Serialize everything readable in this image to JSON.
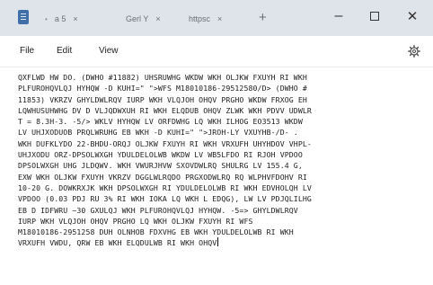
{
  "titlebar": {
    "tabs": [
      {
        "label": "a 5",
        "dot": "•",
        "close": "×"
      },
      {
        "label": "Gerl Y",
        "dot": "•",
        "close": "×"
      },
      {
        "label": "httpsc",
        "dot": "•",
        "close": "×"
      }
    ],
    "new_tab": "+",
    "controls": {
      "minimize": "–",
      "close": "✕"
    }
  },
  "menu": {
    "file": "File",
    "edit": "Edit",
    "view": "View"
  },
  "icons": {
    "app": "notepad-icon",
    "settings": "gear-icon"
  },
  "editor": {
    "lines": [
      "QXFLWD HW DO. (DWHO #11882) UHSRUWHG WKDW WKH OLJKW FXUYH RI WKH",
      "PLFUROHQVLQJ HYHQW -D KUHI=\" \">WFS M18010186-29512580/D> (DWHO #",
      "11853) VKRZV GHYLDWLRQV IURP WKH VLQJOH OHQV PRGHO WKDW FRXOG EH",
      "LQWHUSUHWHG DV D VLJQDWXUH RI WKH ELQDUB OHQV ZLWK WKH PDVV UDWLR",
      "T = 8.3H-3. -5/> WKLV HYHQW LV ORFDWHG LQ WKH ILHOG EO3513 WKDW",
      "LV UHJXODUOB PRQLWRUHG EB WKH -D KUHI=\" \">JROH-LY VXUYHB-/D- .",
      "WKH DUFKLYDO 22-BHDU-ORQJ OLJKW FXUYH RI WKH VRXUFH UHYHDOV VHPL-",
      "UHJXODU ORZ-DPSOLWXGH YDULDELOLWB WKDW LV WB5LFDO RI RJOH VPDOO",
      "DPSOLWXGH UHG JLDQWV. WKH VWURJHVW SXOVDWLRQ SHULRG LV 155.4 G,",
      "EXW WKH OLJKW FXUYH VKRZV DGGLWLRQDO PRGXODWLRQ RQ WLPHVFDOHV RI",
      "10-20 G. DOWKRXJK WKH DPSOLWXGH RI YDULDELOLWB RI WKH EDVHOLQH LV",
      "VPDOO (0.03 PDJ RU 3% RI WKH IOKA LQ WKH L EDQG), LW LV PDJQLILHG",
      "EB D IDFWRU ~30 GXULQJ WKH PLFUROHQVLQJ HYHQW. -5=> GHYLDWLRQV",
      "IURP WKH VLQJOH OHQV PRGHO LQ WKH OLJKW FXUYH RI WFS",
      "M18010186-2951258 DUH OLNHOB FDXVHG EB WKH YDULDELOLWB RI WKH",
      "VRXUFH VWDU, QRW EB WKH ELQDULWB RI WKH OHQV"
    ]
  }
}
